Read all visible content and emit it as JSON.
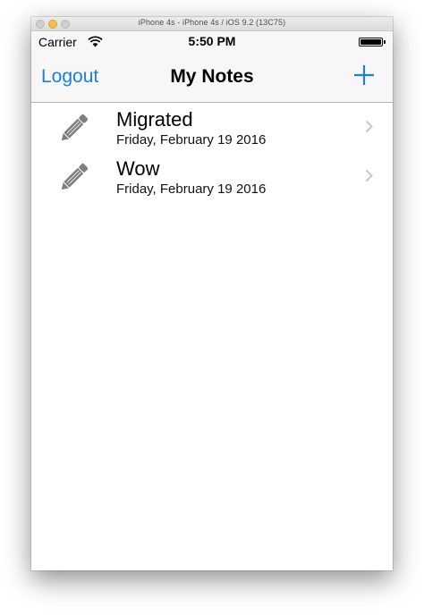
{
  "window": {
    "title": "iPhone 4s - iPhone 4s / iOS 9.2 (13C75)"
  },
  "status_bar": {
    "carrier": "Carrier",
    "time": "5:50 PM",
    "wifi_icon": "wifi-icon",
    "battery_icon": "battery-icon"
  },
  "nav": {
    "left_label": "Logout",
    "title": "My Notes",
    "add_icon": "plus-icon"
  },
  "notes": [
    {
      "title": "Migrated",
      "date": "Friday, February 19 2016",
      "icon": "pencil-icon"
    },
    {
      "title": "Wow",
      "date": "Friday, February 19 2016",
      "icon": "pencil-icon"
    }
  ],
  "colors": {
    "accent": "#1a80e0",
    "icon_gray": "#7f7f7f",
    "chevron": "#c7c7cc"
  }
}
